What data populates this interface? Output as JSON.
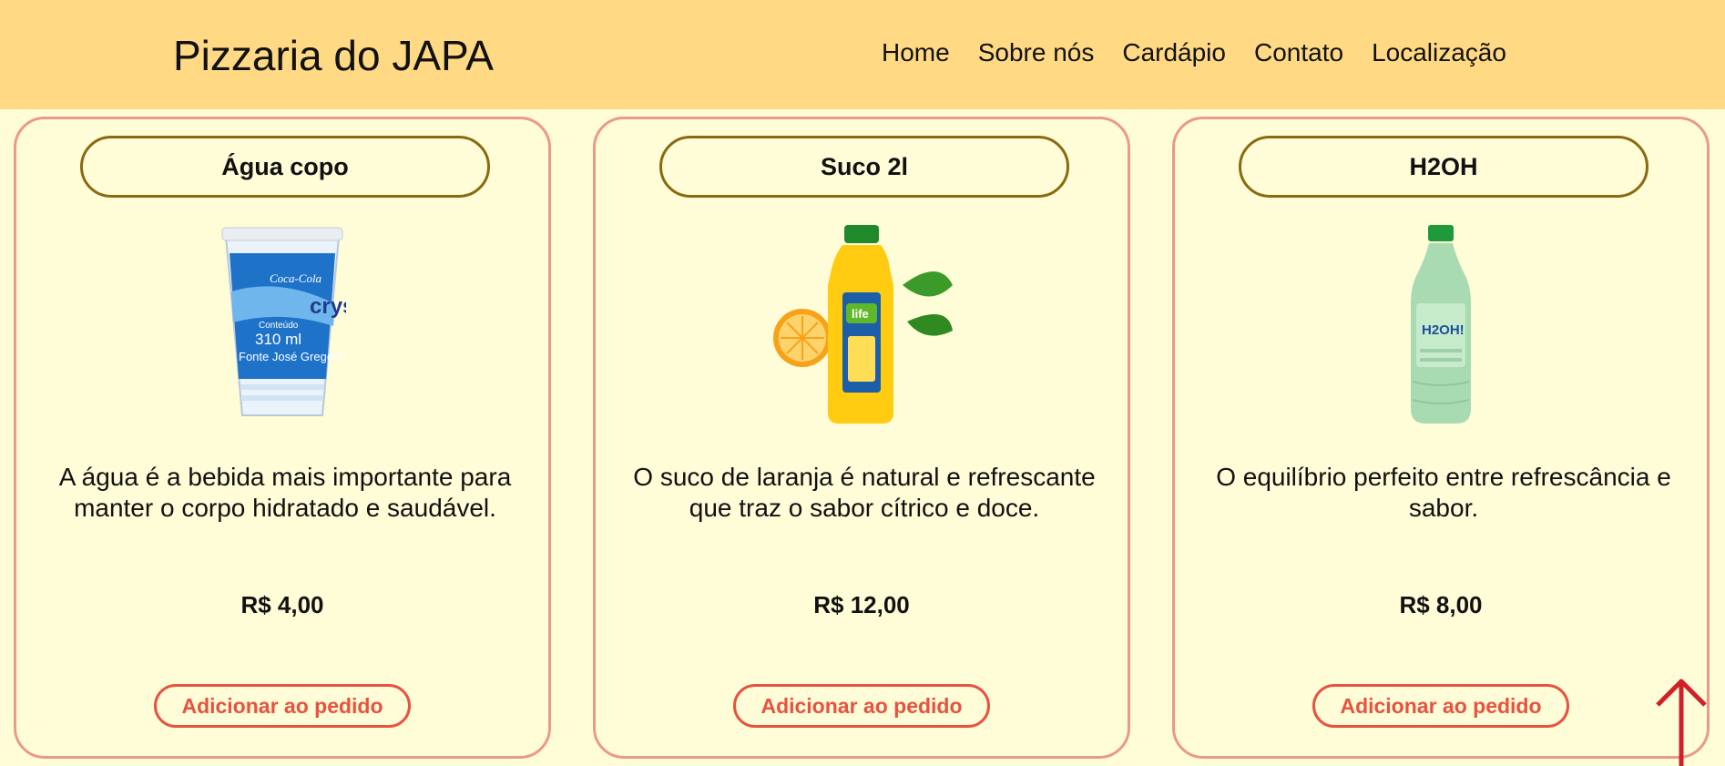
{
  "header": {
    "brand": "Pizzaria do JAPA",
    "nav": [
      "Home",
      "Sobre nós",
      "Cardápio",
      "Contato",
      "Localização"
    ]
  },
  "products": [
    {
      "name": "Água copo",
      "description": "A água é a bebida mais importante para manter o corpo hidratado e saudável.",
      "price": "R$ 4,00",
      "button": "Adicionar ao pedido",
      "image": "water-cup-image",
      "label_brand": "Coca-Cola",
      "label_crys": "crys",
      "label_content": "Conteúdo",
      "label_volume": "310 ml",
      "label_source": "Fonte José Gregório"
    },
    {
      "name": "Suco 2l",
      "description": "O suco de laranja é natural e refrescante que traz o sabor cítrico e doce.",
      "price": "R$ 12,00",
      "button": "Adicionar ao pedido",
      "image": "orange-juice-bottle-image",
      "label_brand": "life"
    },
    {
      "name": "H2OH",
      "description": "O equilíbrio perfeito entre refrescância e sabor.",
      "price": "R$ 8,00",
      "button": "Adicionar ao pedido",
      "image": "h2oh-bottle-image",
      "label_brand": "H2OH!"
    }
  ],
  "colors": {
    "header_bg": "#ffd983",
    "page_bg": "#fffcd8",
    "card_border": "#ea9a86",
    "title_border": "#8a6a10",
    "button_accent": "#e8523f",
    "scroll_arrow": "#d0202a"
  },
  "scroll_top_icon": "arrow-up-icon"
}
